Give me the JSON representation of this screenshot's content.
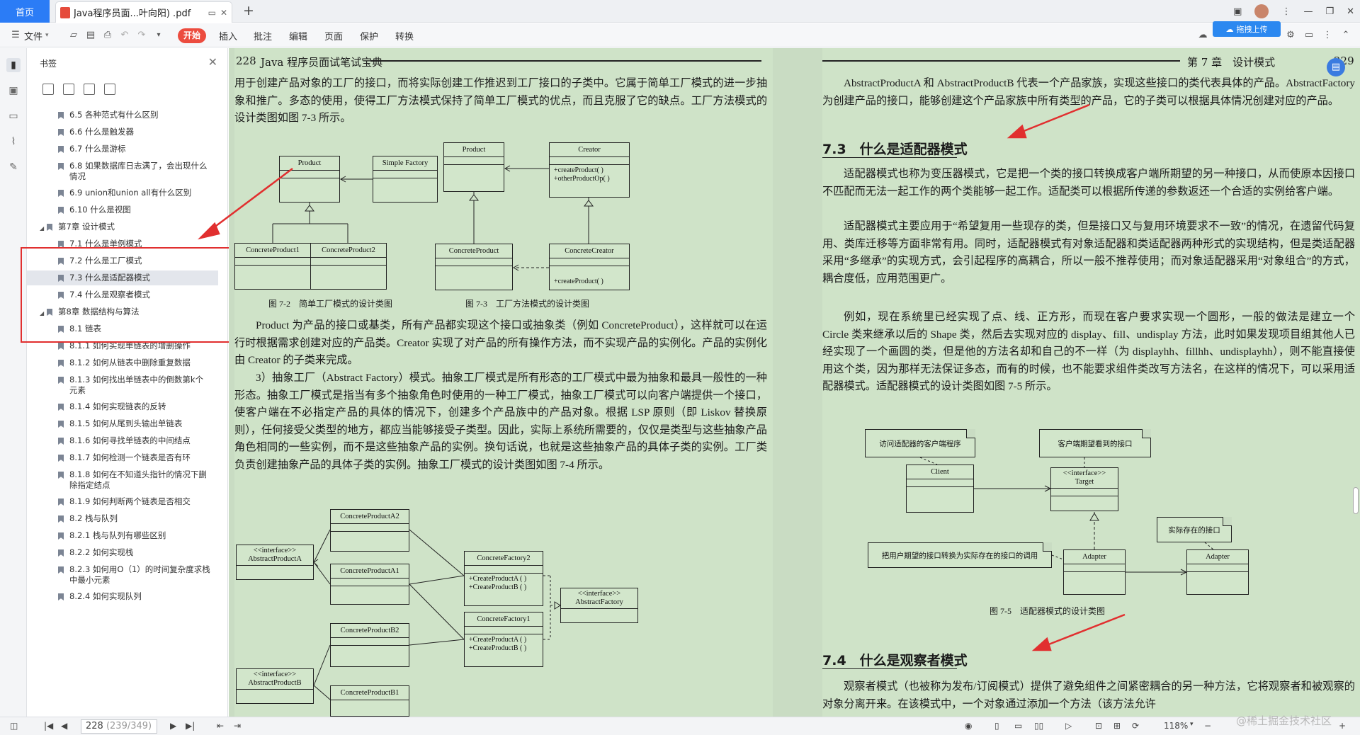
{
  "tabs": {
    "home": "首页",
    "doc_title": "Java程序员面...叶向阳) .pdf"
  },
  "toolbar": {
    "file": "文件",
    "start": "开始",
    "insert": "插入",
    "annotate": "批注",
    "edit": "编辑",
    "page": "页面",
    "protect": "保护",
    "convert": "转换",
    "upload": "拖拽上传"
  },
  "panel": {
    "title": "书签"
  },
  "bookmarks": [
    {
      "label": "6.5 各种范式有什么区别",
      "level": 2
    },
    {
      "label": "6.6 什么是触发器",
      "level": 2
    },
    {
      "label": "6.7 什么是游标",
      "level": 2
    },
    {
      "label": "6.8 如果数据库日志满了，会出现什么情况",
      "level": 2
    },
    {
      "label": "6.9 union和union all有什么区别",
      "level": 2
    },
    {
      "label": "6.10 什么是视图",
      "level": 2
    },
    {
      "label": "第7章 设计模式",
      "level": 1
    },
    {
      "label": "7.1 什么是单例模式",
      "level": 2
    },
    {
      "label": "7.2 什么是工厂模式",
      "level": 2
    },
    {
      "label": "7.3 什么是适配器模式",
      "level": 2,
      "selected": true
    },
    {
      "label": "7.4 什么是观察者模式",
      "level": 2
    },
    {
      "label": "第8章 数据结构与算法",
      "level": 1
    },
    {
      "label": "8.1 链表",
      "level": 2
    },
    {
      "label": "8.1.1 如何实现单链表的增删操作",
      "level": 2
    },
    {
      "label": "8.1.2 如何从链表中删除重复数据",
      "level": 2
    },
    {
      "label": "8.1.3 如何找出单链表中的倒数第k个元素",
      "level": 2
    },
    {
      "label": "8.1.4 如何实现链表的反转",
      "level": 2
    },
    {
      "label": "8.1.5 如何从尾到头输出单链表",
      "level": 2
    },
    {
      "label": "8.1.6 如何寻找单链表的中间结点",
      "level": 2
    },
    {
      "label": "8.1.7 如何检测一个链表是否有环",
      "level": 2
    },
    {
      "label": "8.1.8 如何在不知道头指针的情况下删除指定结点",
      "level": 2
    },
    {
      "label": "8.1.9 如何判断两个链表是否相交",
      "level": 2
    },
    {
      "label": "8.2 栈与队列",
      "level": 2
    },
    {
      "label": "8.2.1 栈与队列有哪些区别",
      "level": 2
    },
    {
      "label": "8.2.2 如何实现栈",
      "level": 2
    },
    {
      "label": "8.2.3 如何用O（1）的时间复杂度求栈中最小元素",
      "level": 2
    },
    {
      "label": "8.2.4 如何实现队列",
      "level": 2
    }
  ],
  "left_page": {
    "page_no": "228",
    "book_title": "Java 程序员面试笔试宝典",
    "p1": "用于创建产品对象的工厂的接口，而将实际创建工作推迟到工厂接口的子类中。它属于简单工厂模式的进一步抽象和推广。多态的使用，使得工厂方法模式保持了简单工厂模式的优点，而且克服了它的缺点。工厂方法模式的设计类图如图 7-3 所示。",
    "fig72": "图 7-2　简单工厂模式的设计类图",
    "fig73": "图 7-3　工厂方法模式的设计类图",
    "p2": "Product 为产品的接口或基类，所有产品都实现这个接口或抽象类（例如 ConcreteProduct），这样就可以在运行时根据需求创建对应的产品类。Creator 实现了对产品的所有操作方法，而不实现产品的实例化。产品的实例化由 Creator 的子类来完成。",
    "p3": "3）抽象工厂（Abstract Factory）模式。抽象工厂模式是所有形态的工厂模式中最为抽象和最具一般性的一种形态。抽象工厂模式是指当有多个抽象角色时使用的一种工厂模式，抽象工厂模式可以向客户端提供一个接口，使客户端在不必指定产品的具体的情况下，创建多个产品族中的产品对象。根据 LSP 原则（即 Liskov 替换原则），任何接受父类型的地方，都应当能够接受子类型。因此，实际上系统所需要的，仅仅是类型与这些抽象产品角色相同的一些实例，而不是这些抽象产品的实例。换句话说，也就是这些抽象产品的具体子类的实例。工厂类负责创建抽象产品的具体子类的实例。抽象工厂模式的设计类图如图 7-4 所示。",
    "uml": {
      "product": "Product",
      "simple_factory": "Simple Factory",
      "cp1": "ConcreteProduct1",
      "cp2": "ConcreteProduct2",
      "product2": "Product",
      "creator": "Creator",
      "creator_ops": "+createProduct( )\n+otherProductOp( )",
      "concrete_product": "ConcreteProduct",
      "concrete_creator": "ConcreteCreator",
      "cc_ops": "+createProduct( )",
      "cpa2": "ConcreteProductA2",
      "ipa": "<<interface>>\nAbstractProductA",
      "cpa1": "ConcreteProductA1",
      "cf2": "ConcreteFactory2",
      "cf2_ops": "+CreateProductA ( )\n+CreateProductB ( )",
      "iaf": "<<interface>>\nAbstractFactory",
      "cf1": "ConcreteFactory1",
      "cf1_ops": "+CreateProductA ( )\n+CreateProductB ( )",
      "cpb2": "ConcreteProductB2",
      "ipb": "<<interface>>\nAbstractProductB",
      "cpb1": "ConcreteProductB1"
    }
  },
  "right_page": {
    "page_no": "229",
    "chapter": "第 7 章　设计模式",
    "p0": "AbstractProductA 和 AbstractProductB 代表一个产品家族，实现这些接口的类代表具体的产品。AbstractFactory 为创建产品的接口，能够创建这个产品家族中所有类型的产品，它的子类可以根据具体情况创建对应的产品。",
    "sec73": "7.3　什么是适配器模式",
    "p1": "适配器模式也称为变压器模式，它是把一个类的接口转换成客户端所期望的另一种接口，从而使原本因接口不匹配而无法一起工作的两个类能够一起工作。适配类可以根据所传递的参数返还一个合适的实例给客户端。",
    "p2": "适配器模式主要应用于“希望复用一些现存的类，但是接口又与复用环境要求不一致”的情况，在遗留代码复用、类库迁移等方面非常有用。同时，适配器模式有对象适配器和类适配器两种形式的实现结构，但是类适配器采用“多继承”的实现方式，会引起程序的高耦合，所以一般不推荐使用；而对象适配器采用“对象组合”的方式，耦合度低，应用范围更广。",
    "p3": "例如，现在系统里已经实现了点、线、正方形，而现在客户要求实现一个圆形，一般的做法是建立一个 Circle 类来继承以后的 Shape 类，然后去实现对应的 display、fill、undisplay 方法，此时如果发现项目组其他人已经实现了一个画圆的类，但是他的方法名却和自己的不一样（为 displayhh、fillhh、undisplayhh），则不能直接使用这个类，因为那样无法保证多态，而有的时候，也不能要求组件类改写方法名，在这样的情况下，可以采用适配器模式。适配器模式的设计类图如图 7-5 所示。",
    "fig75": "图 7-5　适配器模式的设计类图",
    "sec74": "7.4　什么是观察者模式",
    "p4": "观察者模式（也被称为发布/订阅模式）提供了避免组件之间紧密耦合的另一种方法，它将观察者和被观察的对象分离开来。在该模式中，一个对象通过添加一个方法（该方法允许",
    "uml": {
      "note_client": "访问适配器的客户端程序",
      "note_target": "客户端期望看到的接口",
      "client": "Client",
      "target": "<<interface>>\nTarget",
      "note_exist": "实际存在的接口",
      "note_adapter": "把用户期望的接口转换为实际存在的接口的调用",
      "adapter": "Adapter",
      "adaptee": "Adapter"
    }
  },
  "status": {
    "page_current": "228",
    "page_total": "(239/349)",
    "zoom": "118%"
  },
  "watermark": "@稀土掘金技术社区",
  "colors": {
    "accent": "#2b7cf6",
    "start": "#ec4c3f",
    "annotation": "#e12f2f",
    "page_bg": "#cfe3c8"
  }
}
